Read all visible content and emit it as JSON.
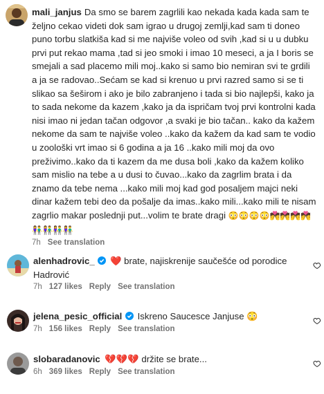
{
  "caption": {
    "username": "mali_janjus",
    "text": "Da smo se barem zagrlili kao nekada kada kada sam te željno cekao videti dok sam igrao u drugoj zemlji,kad sam ti doneo puno torbu slatkiša kad si me najviše voleo od svih ,kad si u u dubku prvi put rekao mama ,tad si jeo smoki i imao 10 meseci, a ja I boris se smejali a sad placemo mili moj..kako si samo bio nemiran svi te grdili a ja se radovao..Sećam se kad si krenuo u prvi razred samo si se ti slikao sa šeširom i ako je bilo zabranjeno i tada si bio najlepši, kako ja to sada nekome da kazem ,kako ja da ispričam tvoj prvi kontrolni kada nisi imao ni jedan tačan odgovor ,a svaki je bio tačan.. kako da kažem nekome da sam te najviše voleo ..kako da kažem da kad sam te vodio u zoološki vrt imao si 6 godina a ja 16 ..kako mili moj da ovo preživimo..kako da ti kazem da me dusa boli ,kako da kažem koliko sam mislio na tebe a u dusi to čuvao...kako da zagrlim brata i da znamo da tebe nema ...kako mili moj kad god posaljem majci neki dinar kažem tebi deo da pošalje da imas..kako mili...kako mili te nisam zagrlio makar poslednji put...volim te brate dragi",
    "emojis": "😳😳😳😳💏💏💏💏👫👫👫👫",
    "time": "7h",
    "see_translation": "See translation"
  },
  "comments": [
    {
      "username": "alenhadrovic_",
      "prefix_emoji": "❤️",
      "text": "brate, najiskrenije saučešće od porodice Hadrović",
      "time": "7h",
      "likes": "127 likes",
      "reply": "Reply",
      "see_translation": "See translation"
    },
    {
      "username": "jelena_pesic_official",
      "prefix_emoji": "",
      "text": "Iskreno Saucesce Janjuse 😳",
      "time": "7h",
      "likes": "156 likes",
      "reply": "Reply",
      "see_translation": "See translation"
    },
    {
      "username": "slobaradanovic",
      "prefix_emoji": "💔💔💔",
      "text": "držite se brate...",
      "time": "6h",
      "likes": "369 likes",
      "reply": "Reply",
      "see_translation": "See translation"
    }
  ],
  "colors": {
    "verified": "#0095f6",
    "muted": "#737373",
    "text": "#262626"
  }
}
